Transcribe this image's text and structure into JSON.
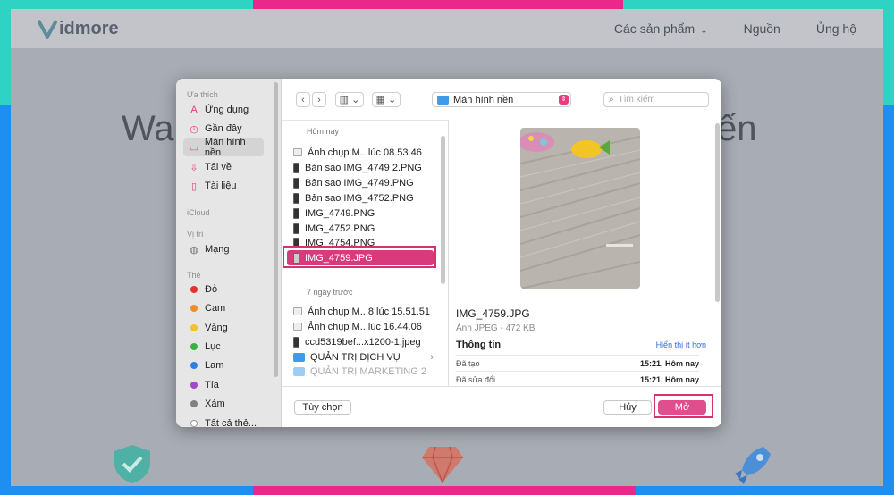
{
  "site": {
    "logo_text": "idmore",
    "nav": [
      "Các sản phẩm",
      "Nguồn",
      "Ủng hộ"
    ],
    "hero_left": "Wa",
    "hero_right": "ến"
  },
  "sidebar": {
    "sections": {
      "favorites": "Ưa thích",
      "icloud": "iCloud",
      "locations": "Vị trí",
      "tags": "Thẻ"
    },
    "favorites": [
      {
        "label": "Ứng dụng",
        "icon": "A"
      },
      {
        "label": "Gần đây",
        "icon": "◷"
      },
      {
        "label": "Màn hình nền",
        "icon": "▭"
      },
      {
        "label": "Tải về",
        "icon": "⇩"
      },
      {
        "label": "Tài liệu",
        "icon": "▯"
      }
    ],
    "locations": [
      {
        "label": "Mạng",
        "icon": "◍"
      }
    ],
    "tags": [
      {
        "label": "Đỏ",
        "color": "#e5322d"
      },
      {
        "label": "Cam",
        "color": "#f28c28"
      },
      {
        "label": "Vàng",
        "color": "#f2c12e"
      },
      {
        "label": "Lục",
        "color": "#35b244"
      },
      {
        "label": "Lam",
        "color": "#2f7de1"
      },
      {
        "label": "Tía",
        "color": "#a349c9"
      },
      {
        "label": "Xám",
        "color": "#808080"
      }
    ],
    "all_tags": "Tất cả thẻ..."
  },
  "toolbar": {
    "location": "Màn hình nền",
    "search_placeholder": "Tìm kiếm"
  },
  "list": {
    "group_today": "Hôm nay",
    "today": [
      {
        "name": "Ảnh chụp M...lúc 08.53.46",
        "kind": "light"
      },
      {
        "name": "Bản sao IMG_4749 2.PNG",
        "kind": "dark"
      },
      {
        "name": "Bản sao IMG_4749.PNG",
        "kind": "dark"
      },
      {
        "name": "Bản sao IMG_4752.PNG",
        "kind": "dark"
      },
      {
        "name": "IMG_4749.PNG",
        "kind": "dark"
      },
      {
        "name": "IMG_4752.PNG",
        "kind": "dark"
      },
      {
        "name": "IMG_4754.PNG",
        "kind": "dark"
      },
      {
        "name": "IMG_4759.JPG",
        "kind": "dark",
        "selected": true
      }
    ],
    "group_week": "7 ngày trước",
    "week": [
      {
        "name": "Ảnh chụp M...8 lúc 15.51.51",
        "kind": "light"
      },
      {
        "name": "Ảnh chụp M...lúc 16.44.06",
        "kind": "light"
      },
      {
        "name": "ccd5319bef...x1200-1.jpeg",
        "kind": "dark"
      },
      {
        "name": "QUẢN TRỊ DỊCH VỤ",
        "kind": "folder"
      },
      {
        "name": "QUẢN TRỊ MARKETING 2",
        "kind": "folder",
        "dim": true
      }
    ]
  },
  "preview": {
    "name": "IMG_4759.JPG",
    "kind": "Ảnh JPEG - 472 KB",
    "info_label": "Thông tin",
    "show_more": "Hiển thị ít hơn",
    "created_label": "Đã tạo",
    "created_value": "15:21, Hôm nay",
    "modified_label": "Đã sửa đổi",
    "modified_value": "15:21, Hôm nay"
  },
  "footer": {
    "options": "Tùy chọn",
    "cancel": "Hủy",
    "open": "Mở"
  },
  "colors": {
    "accent": "#e0407f",
    "selection": "#d83b7c",
    "highlight_box": "#d6336c"
  }
}
